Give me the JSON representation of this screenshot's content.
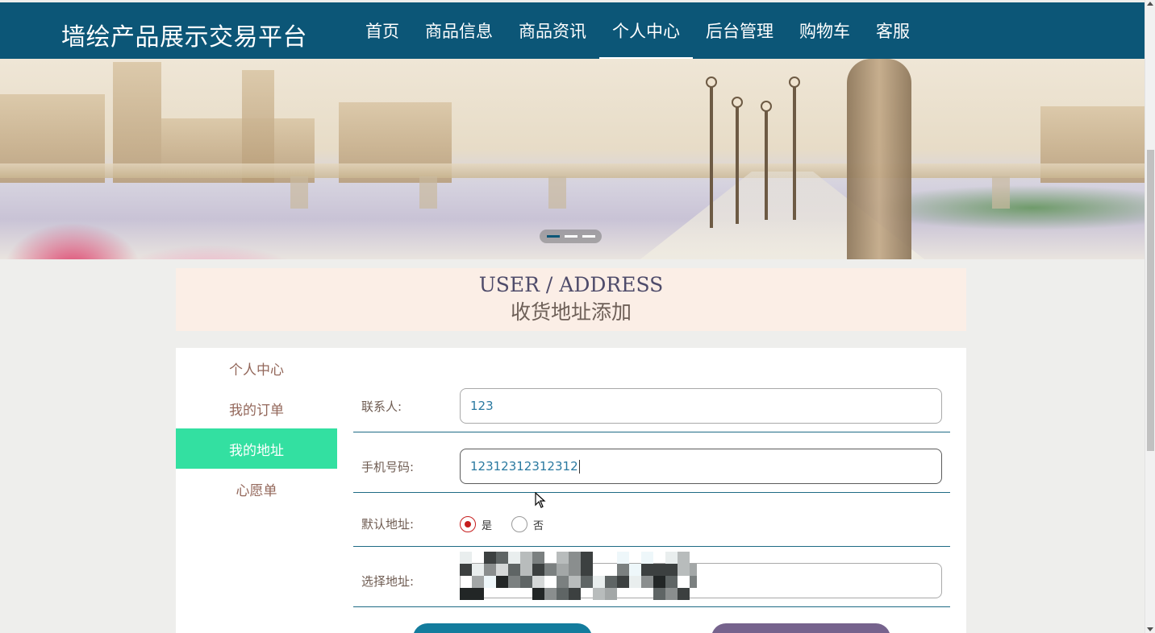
{
  "header": {
    "logo": "墙绘产品展示交易平台",
    "nav": [
      {
        "label": "首页",
        "active": false
      },
      {
        "label": "商品信息",
        "active": false
      },
      {
        "label": "商品资讯",
        "active": false
      },
      {
        "label": "个人中心",
        "active": true
      },
      {
        "label": "后台管理",
        "active": false
      },
      {
        "label": "购物车",
        "active": false
      },
      {
        "label": "客服",
        "active": false
      }
    ],
    "bg_color": "#0c5677"
  },
  "banner": {
    "slides_count": 3,
    "active_slide": 1
  },
  "title": {
    "en": "USER / ADDRESS",
    "cn": "收货地址添加"
  },
  "side_menu": [
    {
      "label": "个人中心",
      "active": false
    },
    {
      "label": "我的订单",
      "active": false
    },
    {
      "label": "我的地址",
      "active": true
    },
    {
      "label": "心愿单",
      "active": false
    }
  ],
  "form": {
    "contact_label": "联系人:",
    "contact_value": "123",
    "phone_label": "手机号码:",
    "phone_value": "12312312312312",
    "default_label": "默认地址:",
    "default_options": [
      {
        "label": "是",
        "checked": true
      },
      {
        "label": "否",
        "checked": false
      }
    ],
    "address_label": "选择地址:"
  },
  "colors": {
    "accent_green": "#33e0a1",
    "title_bg": "#fbeee6",
    "button_blue": "#137c9d",
    "button_purple": "#76638d"
  }
}
